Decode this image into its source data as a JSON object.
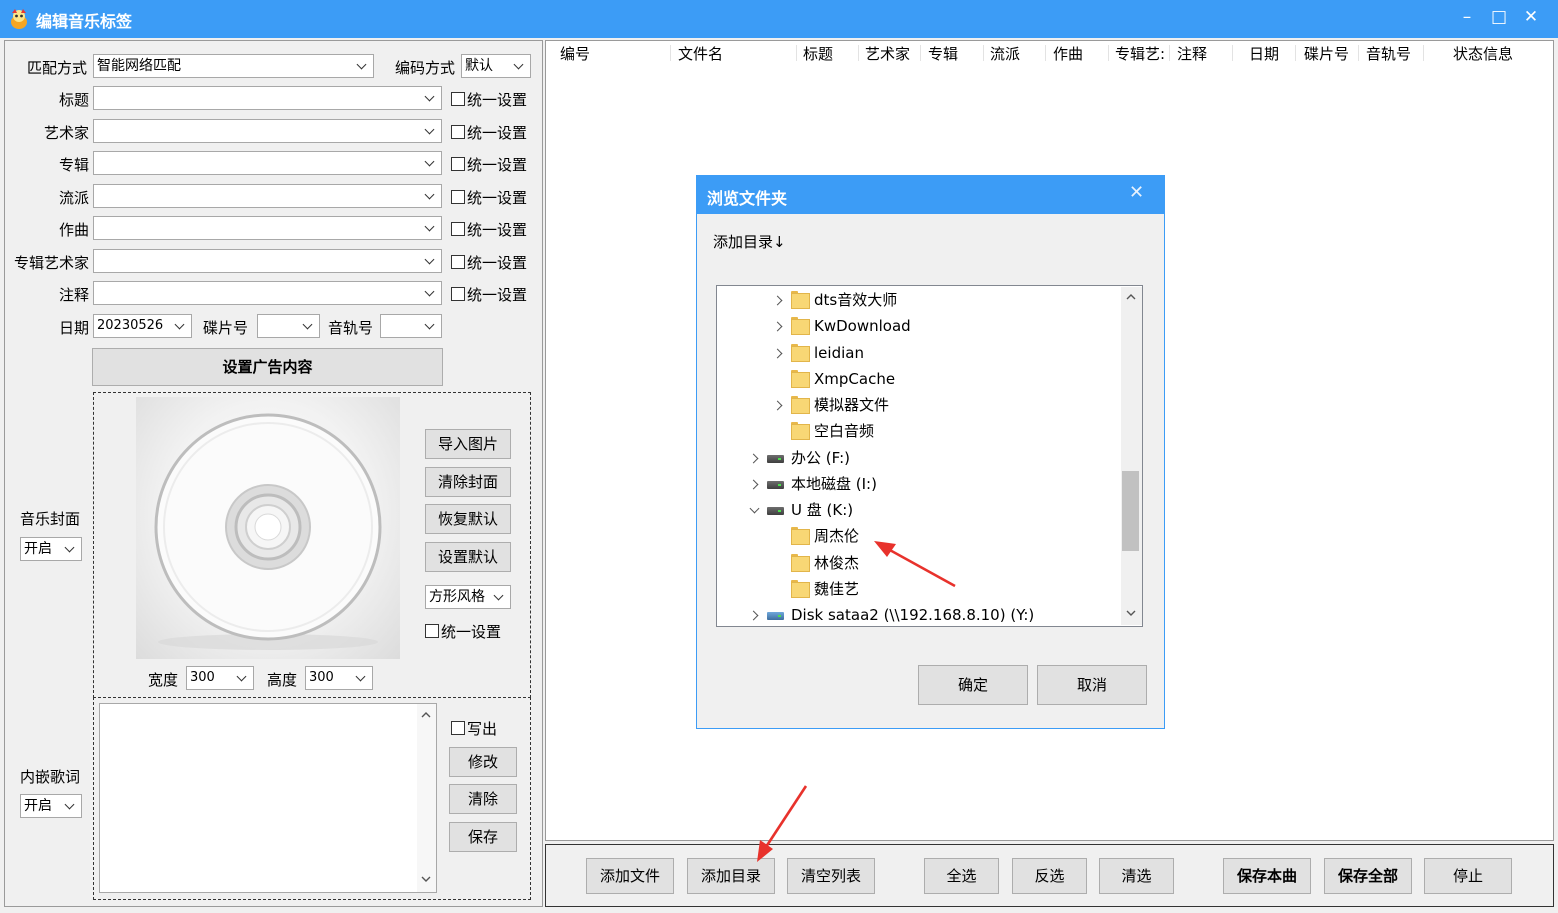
{
  "window": {
    "title": "编辑音乐标签",
    "controls": [
      "–",
      "□",
      "✕"
    ]
  },
  "form": {
    "match_label": "匹配方式",
    "match_value": "智能网络匹配",
    "encoding_label": "编码方式",
    "encoding_value": "默认",
    "fields": [
      {
        "label": "标题",
        "value": "",
        "check": "统一设置"
      },
      {
        "label": "艺术家",
        "value": "",
        "check": "统一设置"
      },
      {
        "label": "专辑",
        "value": "",
        "check": "统一设置"
      },
      {
        "label": "流派",
        "value": "",
        "check": "统一设置"
      },
      {
        "label": "作曲",
        "value": "",
        "check": "统一设置"
      },
      {
        "label": "专辑艺术家",
        "value": "",
        "check": "统一设置"
      },
      {
        "label": "注释",
        "value": "",
        "check": "统一设置"
      }
    ],
    "date_label": "日期",
    "date_value": "20230526",
    "disc_label": "碟片号",
    "disc_value": "",
    "track_label": "音轨号",
    "track_value": "",
    "ad_button": "设置广告内容"
  },
  "cover": {
    "label": "音乐封面",
    "state": "开启",
    "import_button": "导入图片",
    "clear_button": "清除封面",
    "restore_button": "恢复默认",
    "set_default_button": "设置默认",
    "style_value": "方形风格",
    "unify_check": "统一设置",
    "width_label": "宽度",
    "width_value": "300",
    "height_label": "高度",
    "height_value": "300"
  },
  "lyrics": {
    "label": "内嵌歌词",
    "state": "开启",
    "write_check": "写出",
    "modify_button": "修改",
    "clear_button": "清除",
    "save_button": "保存"
  },
  "list": {
    "columns": [
      "编号",
      "文件名",
      "标题",
      "艺术家",
      "专辑",
      "流派",
      "作曲",
      "专辑艺:",
      "注释",
      "日期",
      "碟片号",
      "音轨号",
      "状态信息"
    ]
  },
  "bottom_buttons": [
    "添加文件",
    "添加目录",
    "清空列表",
    "全选",
    "反选",
    "清选",
    "保存本曲",
    "保存全部",
    "停止"
  ],
  "dialog": {
    "title": "浏览文件夹",
    "close": "✕",
    "prompt": "添加目录↓",
    "tree": [
      {
        "label": "dts音效大师",
        "type": "folder",
        "expander": "closed"
      },
      {
        "label": "KwDownload",
        "type": "folder",
        "expander": "closed"
      },
      {
        "label": "leidian",
        "type": "folder",
        "expander": "closed"
      },
      {
        "label": "XmpCache",
        "type": "folder",
        "expander": "none"
      },
      {
        "label": "模拟器文件",
        "type": "folder",
        "expander": "closed"
      },
      {
        "label": "空白音频",
        "type": "folder",
        "expander": "none"
      },
      {
        "label": "办公 (F:)",
        "type": "drive",
        "expander": "closed"
      },
      {
        "label": "本地磁盘 (I:)",
        "type": "drive",
        "expander": "closed"
      },
      {
        "label": "U 盘 (K:)",
        "type": "drive",
        "expander": "open"
      },
      {
        "label": "周杰伦",
        "type": "folder",
        "expander": "none"
      },
      {
        "label": "林俊杰",
        "type": "folder",
        "expander": "none"
      },
      {
        "label": "魏佳艺",
        "type": "folder",
        "expander": "none"
      },
      {
        "label": "Disk sataa2 (\\\\192.168.8.10) (Y:)",
        "type": "netdrive",
        "expander": "closed"
      }
    ],
    "ok_button": "确定",
    "cancel_button": "取消"
  },
  "colors": {
    "accent": "#3c9cf6",
    "annotation": "#e8322c"
  }
}
